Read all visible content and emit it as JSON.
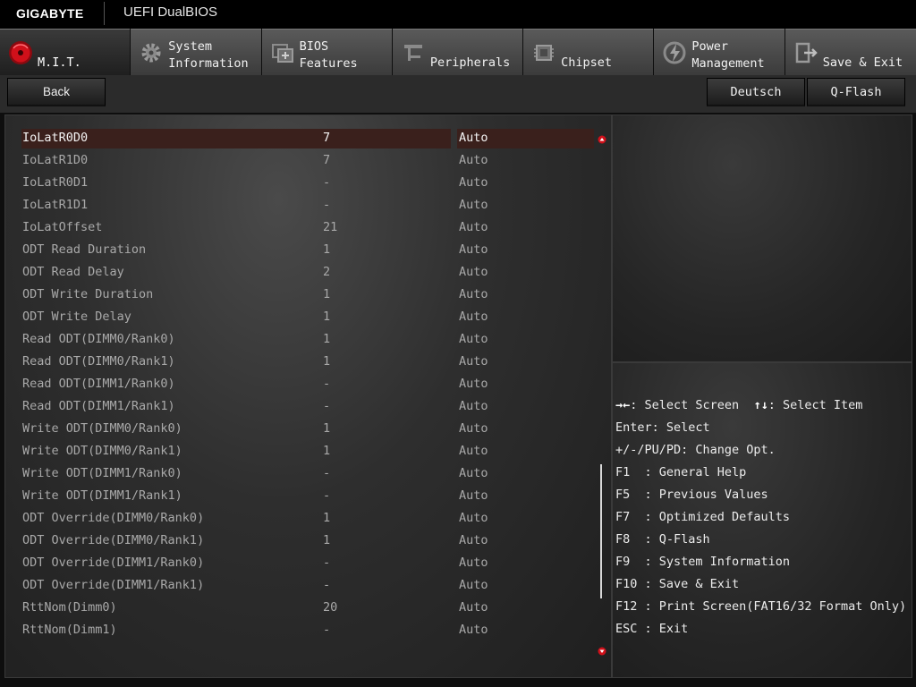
{
  "brand": {
    "logo": "GIGABYTE",
    "product": "UEFI DualBIOS"
  },
  "tabs": [
    {
      "label": "M.I.T.",
      "icon": "mit-dial-icon",
      "active": true
    },
    {
      "label": "System\nInformation",
      "icon": "gear-icon",
      "active": false
    },
    {
      "label": "BIOS\nFeatures",
      "icon": "bios-chip-icon",
      "active": false
    },
    {
      "label": "Peripherals",
      "icon": "peripherals-icon",
      "active": false
    },
    {
      "label": "Chipset",
      "icon": "chipset-icon",
      "active": false
    },
    {
      "label": "Power\nManagement",
      "icon": "power-icon",
      "active": false
    },
    {
      "label": "Save & Exit",
      "icon": "exit-door-icon",
      "active": false
    }
  ],
  "buttons": {
    "back": "Back",
    "language": "Deutsch",
    "qflash": "Q-Flash"
  },
  "settings": [
    {
      "name": "IoLatR0D0",
      "value": "7",
      "option": "Auto"
    },
    {
      "name": "IoLatR1D0",
      "value": "7",
      "option": "Auto"
    },
    {
      "name": "IoLatR0D1",
      "value": "-",
      "option": "Auto"
    },
    {
      "name": "IoLatR1D1",
      "value": "-",
      "option": "Auto"
    },
    {
      "name": "IoLatOffset",
      "value": "21",
      "option": "Auto"
    },
    {
      "name": "ODT Read Duration",
      "value": "1",
      "option": "Auto"
    },
    {
      "name": "ODT Read Delay",
      "value": "2",
      "option": "Auto"
    },
    {
      "name": "ODT Write Duration",
      "value": "1",
      "option": "Auto"
    },
    {
      "name": "ODT Write Delay",
      "value": "1",
      "option": "Auto"
    },
    {
      "name": "Read ODT(DIMM0/Rank0)",
      "value": "1",
      "option": "Auto"
    },
    {
      "name": "Read ODT(DIMM0/Rank1)",
      "value": "1",
      "option": "Auto"
    },
    {
      "name": "Read ODT(DIMM1/Rank0)",
      "value": "-",
      "option": "Auto"
    },
    {
      "name": "Read ODT(DIMM1/Rank1)",
      "value": "-",
      "option": "Auto"
    },
    {
      "name": "Write ODT(DIMM0/Rank0)",
      "value": "1",
      "option": "Auto"
    },
    {
      "name": "Write ODT(DIMM0/Rank1)",
      "value": "1",
      "option": "Auto"
    },
    {
      "name": "Write ODT(DIMM1/Rank0)",
      "value": "-",
      "option": "Auto"
    },
    {
      "name": "Write ODT(DIMM1/Rank1)",
      "value": "-",
      "option": "Auto"
    },
    {
      "name": "ODT Override(DIMM0/Rank0)",
      "value": "1",
      "option": "Auto"
    },
    {
      "name": "ODT Override(DIMM0/Rank1)",
      "value": "1",
      "option": "Auto"
    },
    {
      "name": "ODT Override(DIMM1/Rank0)",
      "value": "-",
      "option": "Auto"
    },
    {
      "name": "ODT Override(DIMM1/Rank1)",
      "value": "-",
      "option": "Auto"
    },
    {
      "name": "RttNom(Dimm0)",
      "value": "20",
      "option": "Auto"
    },
    {
      "name": "RttNom(Dimm1)",
      "value": "-",
      "option": "Auto"
    }
  ],
  "selected_index": 0,
  "help": {
    "select_screen_icon": "→←",
    "select_screen": ": Select Screen",
    "select_item_icon": "↑↓",
    "select_item": ": Select Item",
    "lines": [
      "Enter: Select",
      "+/-/PU/PD: Change Opt.",
      "F1  : General Help",
      "F5  : Previous Values",
      "F7  : Optimized Defaults",
      "F8  : Q-Flash",
      "F9  : System Information",
      "F10 : Save & Exit",
      "F12 : Print Screen(FAT16/32 Format Only)",
      "ESC : Exit"
    ]
  },
  "colors": {
    "selection": "#3a201c",
    "accent_red": "#d0101a"
  }
}
